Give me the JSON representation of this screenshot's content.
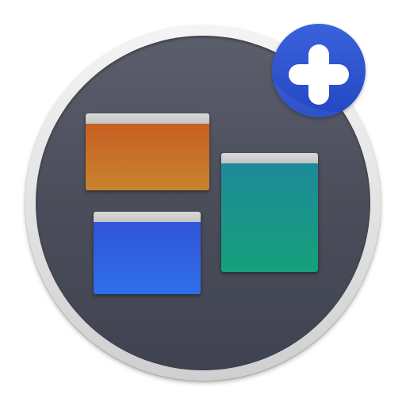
{
  "app_icon": {
    "icons": {
      "main": "app-windows-icon",
      "badge": "plus-icon"
    },
    "colors": {
      "ring": "#e2e2e2",
      "disc": "#4b4e5a",
      "window_bar": "#cfcfcf",
      "orange_window": "#c8742a",
      "teal_window": "#18968a",
      "blue_window": "#2f60df",
      "badge": "#2f56d0",
      "plus": "#ffffff"
    }
  }
}
